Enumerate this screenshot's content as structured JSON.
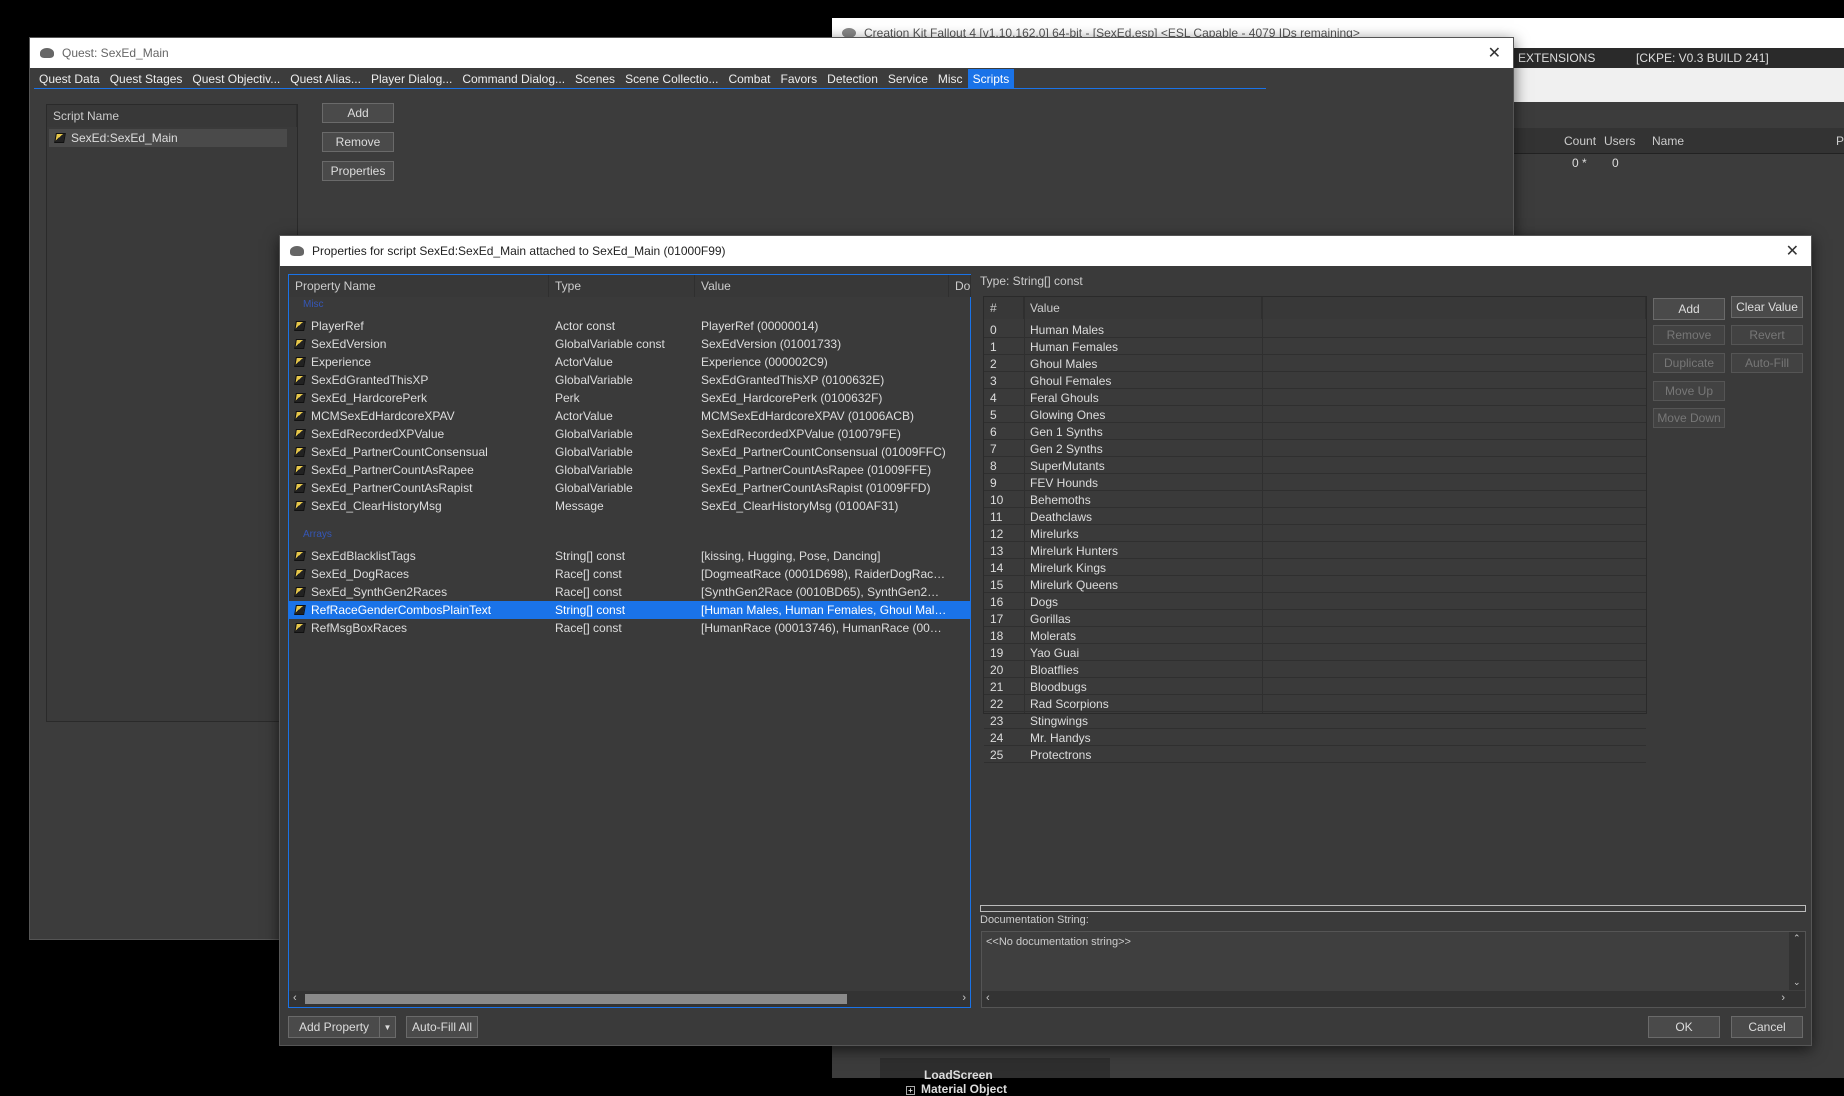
{
  "background_window": {
    "title": "Creation Kit Fallout 4 [v1.10.162.0] 64-bit - [SexEd.esp] <ESL Capable - 4079 IDs remaining>",
    "menu_right": [
      "EXTENSIONS",
      "[CKPE: V0.3 BUILD 241]"
    ],
    "columns": [
      "Count",
      "Users",
      "Name",
      "P"
    ],
    "row_values": [
      "0 *",
      "0"
    ],
    "tree_items": [
      "LoadScreen",
      "Material Object"
    ]
  },
  "quest_window": {
    "title": "Quest: SexEd_Main",
    "tabs": [
      "Quest Data",
      "Quest Stages",
      "Quest Objectiv...",
      "Quest Alias...",
      "Player Dialog...",
      "Command Dialog...",
      "Scenes",
      "Scene Collectio...",
      "Combat",
      "Favors",
      "Detection",
      "Service",
      "Misc",
      "Scripts"
    ],
    "active_tab": 13,
    "script_list_header": "Script Name",
    "scripts": [
      "SexEd:SexEd_Main"
    ],
    "buttons": {
      "add": "Add",
      "remove": "Remove",
      "properties": "Properties"
    }
  },
  "properties_dialog": {
    "title": "Properties for script SexEd:SexEd_Main attached to SexEd_Main (01000F99)",
    "columns": {
      "name": "Property Name",
      "type": "Type",
      "value": "Value",
      "doc": "Do"
    },
    "groups": [
      "Misc",
      "Arrays"
    ],
    "misc_properties": [
      {
        "name": "PlayerRef",
        "type": "Actor const",
        "value": "PlayerRef (00000014)"
      },
      {
        "name": "SexEdVersion",
        "type": "GlobalVariable const",
        "value": "SexEdVersion (01001733)"
      },
      {
        "name": "Experience",
        "type": "ActorValue",
        "value": "Experience (000002C9)"
      },
      {
        "name": "SexEdGrantedThisXP",
        "type": "GlobalVariable",
        "value": "SexEdGrantedThisXP (0100632E)"
      },
      {
        "name": "SexEd_HardcorePerk",
        "type": "Perk",
        "value": "SexEd_HardcorePerk (0100632F)"
      },
      {
        "name": "MCMSexEdHardcoreXPAV",
        "type": "ActorValue",
        "value": "MCMSexEdHardcoreXPAV (01006ACB)"
      },
      {
        "name": "SexEdRecordedXPValue",
        "type": "GlobalVariable",
        "value": "SexEdRecordedXPValue (010079FE)"
      },
      {
        "name": "SexEd_PartnerCountConsensual",
        "type": "GlobalVariable",
        "value": "SexEd_PartnerCountConsensual (01009FFC)"
      },
      {
        "name": "SexEd_PartnerCountAsRapee",
        "type": "GlobalVariable",
        "value": "SexEd_PartnerCountAsRapee (01009FFE)"
      },
      {
        "name": "SexEd_PartnerCountAsRapist",
        "type": "GlobalVariable",
        "value": "SexEd_PartnerCountAsRapist (01009FFD)"
      },
      {
        "name": "SexEd_ClearHistoryMsg",
        "type": "Message",
        "value": "SexEd_ClearHistoryMsg (0100AF31)"
      }
    ],
    "array_properties": [
      {
        "name": "SexEdBlacklistTags",
        "type": "String[] const",
        "value": "[kissing, Hugging, Pose, Dancing]"
      },
      {
        "name": "SexEd_DogRaces",
        "type": "Race[] const",
        "value": "[DogmeatRace (0001D698), RaiderDogRace (0..."
      },
      {
        "name": "SexEd_SynthGen2Races",
        "type": "Race[] const",
        "value": "[SynthGen2Race (0010BD65), SynthGen2Race..."
      },
      {
        "name": "RefRaceGenderCombosPlainText",
        "type": "String[] const",
        "value": "[Human Males, Human Females, Ghoul Males, ..."
      },
      {
        "name": "RefMsgBoxRaces",
        "type": "Race[] const",
        "value": "[HumanRace (00013746), HumanRace (000137..."
      }
    ],
    "selected_property": 3,
    "type_label": "Type: String[] const",
    "array_columns": {
      "index": "#",
      "value": "Value"
    },
    "array_items": [
      "Human Males",
      "Human Females",
      "Ghoul Males",
      "Ghoul Females",
      "Feral Ghouls",
      "Glowing Ones",
      "Gen 1 Synths",
      "Gen 2 Synths",
      "SuperMutants",
      "FEV Hounds",
      "Behemoths",
      "Deathclaws",
      "Mirelurks",
      "Mirelurk Hunters",
      "Mirelurk Kings",
      "Mirelurk Queens",
      "Dogs",
      "Gorillas",
      "Molerats",
      "Yao Guai",
      "Bloatflies",
      "Bloodbugs",
      "Rad Scorpions",
      "Stingwings",
      "Mr. Handys",
      "Protectrons"
    ],
    "array_indices": [
      "0",
      "1",
      "2",
      "3",
      "4",
      "5",
      "6",
      "7",
      "8",
      "9",
      "10",
      "11",
      "12",
      "13",
      "14",
      "15",
      "16",
      "17",
      "18",
      "19",
      "20",
      "21",
      "22",
      "23",
      "24",
      "25"
    ],
    "side_buttons": {
      "add": "Add",
      "clear": "Clear Value",
      "remove": "Remove",
      "revert": "Revert",
      "duplicate": "Duplicate",
      "autofill": "Auto-Fill",
      "move_up": "Move Up",
      "move_down": "Move Down"
    },
    "doc_label": "Documentation String:",
    "doc_text": "<<No documentation string>>",
    "bottom_buttons": {
      "add_property": "Add Property",
      "autofill_all": "Auto-Fill All",
      "ok": "OK",
      "cancel": "Cancel"
    }
  }
}
